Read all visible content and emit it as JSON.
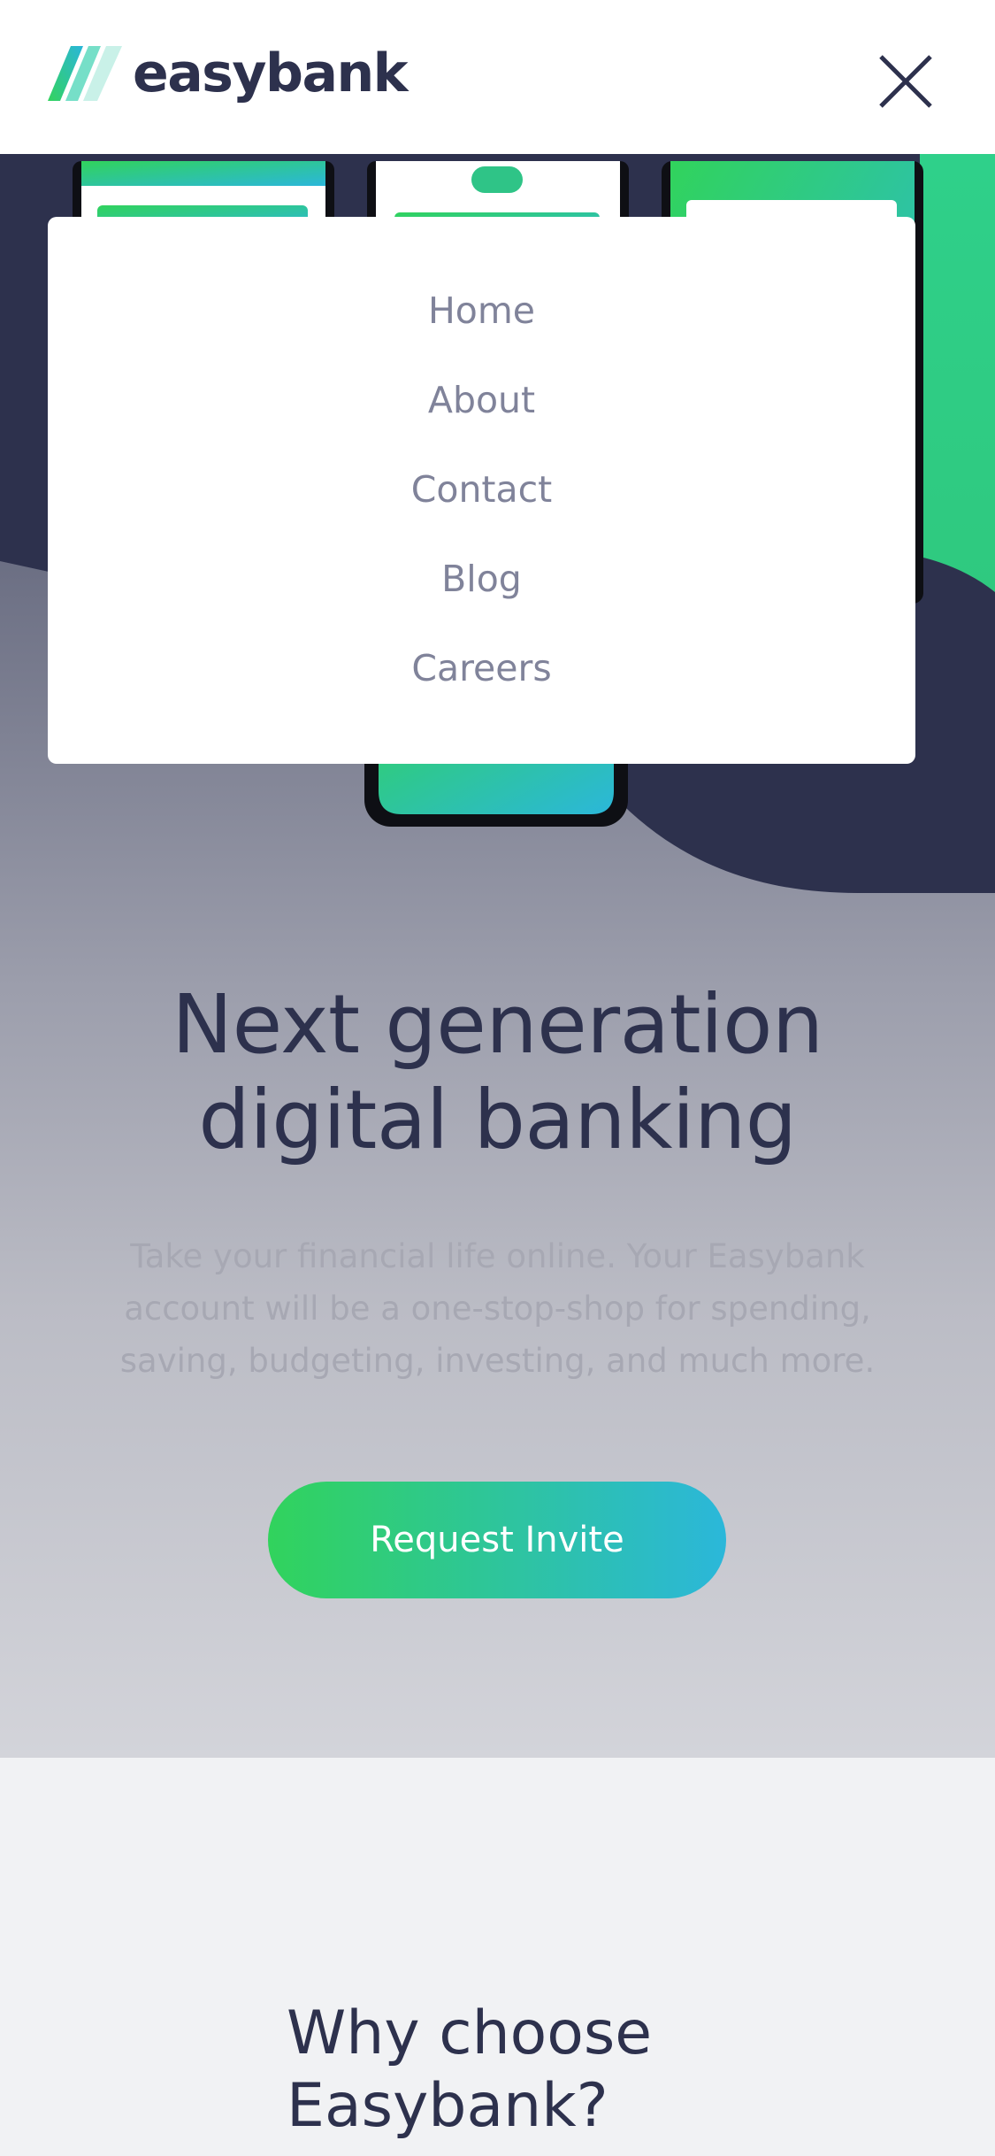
{
  "header": {
    "brand": "easybank",
    "close_icon": "close-icon"
  },
  "menu": {
    "items": [
      {
        "label": "Home"
      },
      {
        "label": "About"
      },
      {
        "label": "Contact"
      },
      {
        "label": "Blog"
      },
      {
        "label": "Careers"
      }
    ]
  },
  "hero": {
    "title_line1": "Next generation",
    "title_line2": "digital banking",
    "description": "Take your financial life online. Your Easybank account will be a one-stop-shop for spending, saving, budgeting, investing, and much more.",
    "cta_label": "Request Invite"
  },
  "why": {
    "title_line1": "Why choose",
    "title_line2": "Easybank?"
  },
  "colors": {
    "dark_blue": "#2d314d",
    "lime_green": "#31d35c",
    "bright_cyan": "#2bb7da",
    "grayish_blue": "#9698a6",
    "light_gray": "#f3f4f6"
  }
}
